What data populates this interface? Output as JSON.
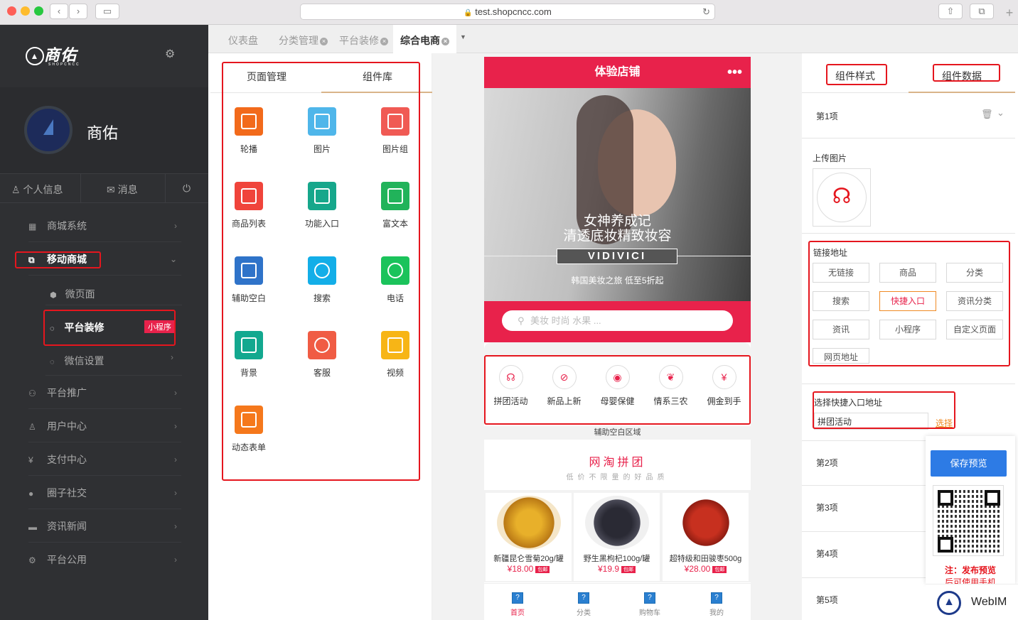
{
  "browser": {
    "url": "test.shopcncc.com"
  },
  "sidebar": {
    "brand": "商佑",
    "brand_sub": "SHOPCNCC",
    "user": "商佑",
    "tabs": [
      "个人信息",
      "消息"
    ],
    "menu": [
      {
        "label": "商城系统"
      },
      {
        "label": "移动商城"
      },
      {
        "label": "微页面"
      },
      {
        "label": "平台装修",
        "badge": "小程序"
      },
      {
        "label": "微信设置"
      },
      {
        "label": "平台推广"
      },
      {
        "label": "用户中心"
      },
      {
        "label": "支付中心"
      },
      {
        "label": "圈子社交"
      },
      {
        "label": "资讯新闻"
      },
      {
        "label": "平台公用"
      }
    ]
  },
  "top_tabs": [
    "仪表盘",
    "分类管理",
    "平台装修",
    "综合电商"
  ],
  "left_panel": {
    "tabs": [
      "页面管理",
      "组件库"
    ],
    "components": [
      "轮播",
      "图片",
      "图片组",
      "商品列表",
      "功能入口",
      "富文本",
      "辅助空白",
      "搜索",
      "电话",
      "背景",
      "客服",
      "视频",
      "动态表单"
    ]
  },
  "preview": {
    "title": "体验店铺",
    "banner": {
      "line1": "女神养成记",
      "line2": "清透底妆精致妆容",
      "brand": "VIDIVICI",
      "line3": "韩国美妆之旅 低至5折起"
    },
    "search_placeholder": "美妆 时尚 水果 ...",
    "nav": [
      "拼团活动",
      "新品上新",
      "母婴保健",
      "情系三农",
      "佣金到手"
    ],
    "spacer_label": "辅助空白区域",
    "group_title": "网淘拼团",
    "group_sub": "低价不限量的好品质",
    "products": [
      {
        "name": "新疆昆仑雪菊20g/罐",
        "price": "¥18.00",
        "tag": "包邮"
      },
      {
        "name": "野生黑枸杞100g/罐",
        "price": "¥19.9",
        "tag": "包邮"
      },
      {
        "name": "超特级和田骏枣500g",
        "price": "¥28.00",
        "tag": "包邮"
      }
    ],
    "tabbar": [
      "首页",
      "分类",
      "购物车",
      "我的"
    ]
  },
  "right_panel": {
    "tabs": [
      "组件样式",
      "组件数据"
    ],
    "item1": "第1项",
    "upload_label": "上传图片",
    "link_label": "链接地址",
    "link_options": [
      "无链接",
      "商品",
      "分类",
      "搜索",
      "快捷入口",
      "资讯分类",
      "资讯",
      "小程序",
      "自定义页面",
      "网页地址"
    ],
    "selected_link": "快捷入口",
    "quick_label": "选择快捷入口地址",
    "quick_value": "拼团活动",
    "choose": "选择",
    "items": [
      "第2项",
      "第3项",
      "第4项",
      "第5项"
    ],
    "save_btn": "保存预览",
    "note_line1": "注：发布预览",
    "note_line2": "后可使用手机",
    "webim": "WebIM"
  },
  "colors": {
    "accent": "#e8224b",
    "sidebar": "#2f3033",
    "primary": "#2d7be5",
    "highlight": "#e5161e"
  }
}
